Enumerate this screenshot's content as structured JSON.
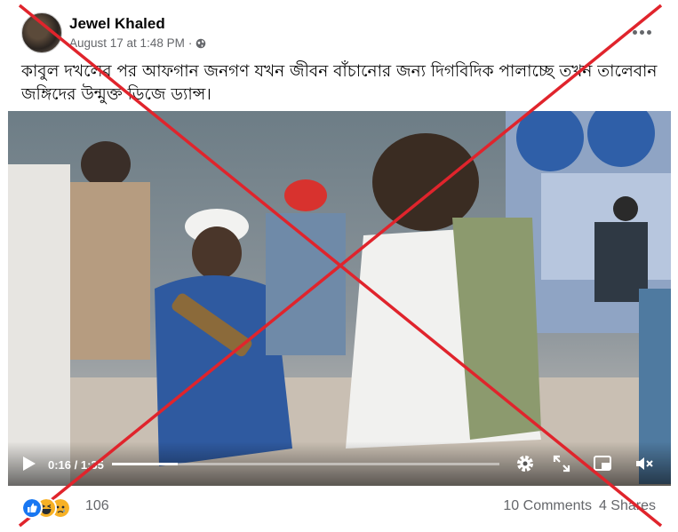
{
  "post": {
    "author": "Jewel Khaled",
    "timestamp": "August 17 at 1:48 PM",
    "separator": "·",
    "caption": "কাবুল দখলের পর আফগান জনগণ যখন জীবন বাঁচানোর জন্য দিগবিদিক পালাচ্ছে তখন তালেবান জঙ্গিদের উন্মুক্ত ডিজে ড্যান্স।"
  },
  "video": {
    "current_time": "0:16",
    "duration": "1:35",
    "time_separator": " / ",
    "progress_fraction": 0.17
  },
  "footer": {
    "reaction_count": "106",
    "comments": "10 Comments",
    "shares": "4 Shares"
  },
  "icons": {
    "privacy": "globe-icon",
    "more": "more-options-icon",
    "play": "play-icon",
    "settings": "gear-icon",
    "fullscreen": "expand-icon",
    "pip": "picture-in-picture-icon",
    "volume": "mute-icon"
  },
  "colors": {
    "cross": "#e0242c",
    "like": "#1877f2",
    "haha": "#f7b125",
    "sad": "#f7b125"
  }
}
